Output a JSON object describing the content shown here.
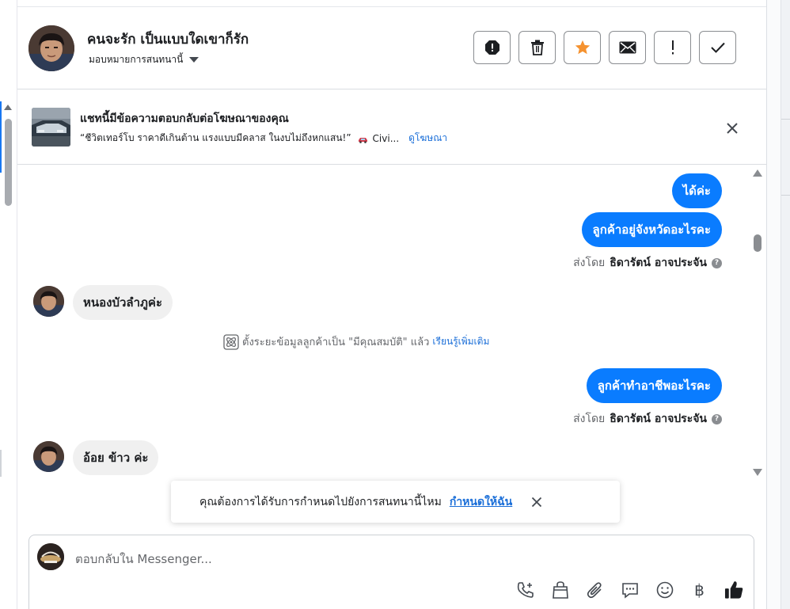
{
  "header": {
    "contact_name": "คนจะรัก เป็นแบบใดเขาก็รัก",
    "assign_label": "มอบหมายการสนทนานี้",
    "actions": [
      {
        "name": "report-spam-button",
        "icon": "exclamation-octagon-icon"
      },
      {
        "name": "delete-button",
        "icon": "trash-icon"
      },
      {
        "name": "star-button",
        "icon": "star-icon"
      },
      {
        "name": "mark-unread-button",
        "icon": "envelope-icon"
      },
      {
        "name": "follow-up-button",
        "icon": "exclamation-icon"
      },
      {
        "name": "mark-done-button",
        "icon": "checkmark-icon"
      }
    ],
    "star_color": "#f5922f"
  },
  "ad": {
    "title": "แชทนี้มีข้อความตอบกลับต่อโฆษณาของคุณ",
    "description": "“ชีวิตเทอร์โบ ราคาดีเกินต้าน แรงแบบมีคลาส ในงบไม่ถึงหกแสน!”",
    "description_tail": "Civi...",
    "link": "ดูโฆษณา"
  },
  "thread": {
    "messages_out_1": [
      "ได้ค่ะ",
      "ลูกค้าอยู่จังหวัดอะไรคะ"
    ],
    "sent_by_prefix": "ส่งโดย",
    "sent_by_name": "ธิดารัตน์ อาจประจัน",
    "reply_1": "หนองบัวลำภูค่ะ",
    "system_note": "ตั้งระยะข้อมูลลูกค้าเป็น \"มีคุณสมบัติ\" แล้ว",
    "system_note_link": "เรียนรู้เพิ่มเติม",
    "message_out_2": "ลูกค้าทำอาชีพอะไรคะ",
    "reply_2": "อ้อย ข้าว ค่ะ",
    "bubble_color": "#0a7cff"
  },
  "toast": {
    "text": "คุณต้องการได้รับการกำหนดไปยังการสนทนานี้ไหม",
    "link": "กำหนดให้ฉัน"
  },
  "composer": {
    "placeholder": "ตอบกลับใน Messenger...",
    "tools": [
      "phone-add-icon",
      "shopping-bag-icon",
      "paperclip-icon",
      "saved-replies-icon",
      "emoji-icon",
      "baht-icon",
      "thumbs-up-icon"
    ],
    "baht_symbol": "฿"
  }
}
